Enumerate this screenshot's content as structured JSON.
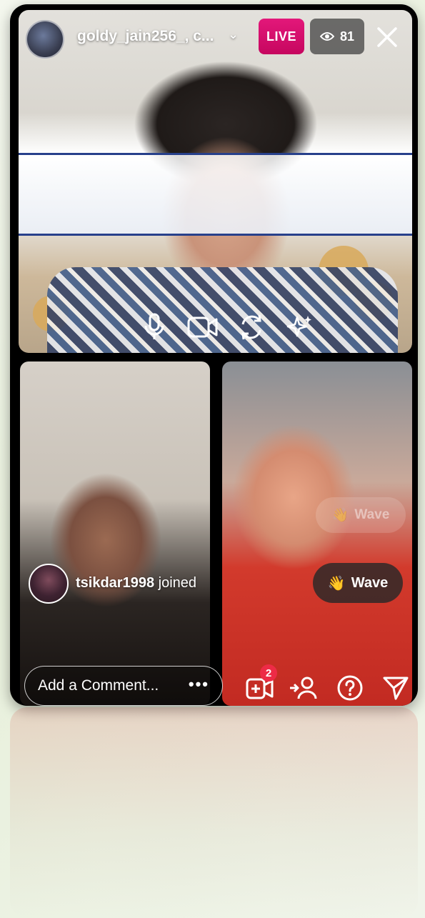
{
  "host": {
    "username": "goldy_jain256_, c...",
    "live_label": "LIVE",
    "viewer_count": "81",
    "icons": [
      "avatar",
      "chevron-down-icon",
      "eye-icon",
      "close-icon"
    ]
  },
  "host_controls": {
    "icons": [
      "microphone-icon",
      "video-camera-icon",
      "switch-camera-icon",
      "effects-sparkle-icon"
    ]
  },
  "guest_panel": {
    "joined_username": "tsikdar1998",
    "joined_suffix": " joined",
    "wave_emoji": "👋",
    "wave_label": "Wave"
  },
  "comment_bar": {
    "placeholder": "Add a Comment...",
    "more_label": "•••",
    "requests_badge": "2",
    "icons": [
      "add-guest-icon",
      "invite-user-icon",
      "question-icon",
      "send-icon"
    ]
  },
  "colors": {
    "live_badge": "#e3187a",
    "badge_red": "#ed2b46",
    "viewer_badge_bg": "#3c3c3c"
  }
}
